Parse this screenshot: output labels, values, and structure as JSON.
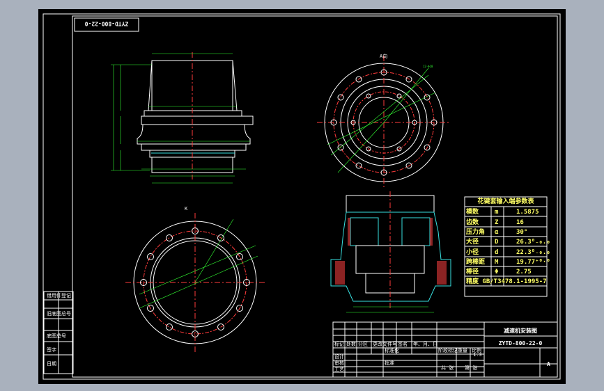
{
  "drawing": {
    "drawing_number_rotated": "ZYTD-800-22-0",
    "view_a_label": "A向",
    "view_k_label": "K",
    "bolt_callout": "12-Φ18"
  },
  "spline_table": {
    "title": "花键套输入端参数表",
    "rows": [
      {
        "name": "模数",
        "symbol": "m",
        "value": "1.5875"
      },
      {
        "name": "齿数",
        "symbol": "Z",
        "value": "16"
      },
      {
        "name": "压力角",
        "symbol": "α",
        "value": "30°"
      },
      {
        "name": "大径",
        "symbol": "D",
        "value": "26.3⁰₋₀.₀"
      },
      {
        "name": "小径",
        "symbol": "d",
        "value": "22.3⁰₋₀.₀"
      },
      {
        "name": "跨棒距",
        "symbol": "M",
        "value": "19.77⁺⁰·⁰"
      },
      {
        "name": "棒径",
        "symbol": "Φ",
        "value": "2.75"
      }
    ],
    "standard": "精度 GB/T3478.1-1995-7"
  },
  "title_block": {
    "drawing_name": "减速机安装图",
    "drawing_number": "ZYTD-800-22-0",
    "scale": "1:3",
    "sheet_label": "A",
    "col_headers": [
      "标记",
      "处数",
      "分区",
      "更改文件号",
      "签名",
      "年、月、日"
    ],
    "roles": [
      "设计",
      "审核",
      "工艺"
    ],
    "standardization": "标准化",
    "approve": "批准",
    "stage_label": "阶段标记",
    "weight_label": "重量",
    "scale_label": "比例",
    "sheet_count": "共 张",
    "sheet_no": "第 张"
  },
  "side_stamp": [
    "借用件登记",
    "旧底图总号",
    "底图总号",
    "签字",
    "日期"
  ],
  "colors": {
    "sheet_bg": "#000000",
    "outer_bg": "#a9b1bd",
    "line_white": "#ffffff",
    "centerline_red": "#ff3b3b",
    "dimension_green": "#33ff33",
    "section_cyan": "#38e0e0",
    "hatch_red": "#ff4040"
  }
}
